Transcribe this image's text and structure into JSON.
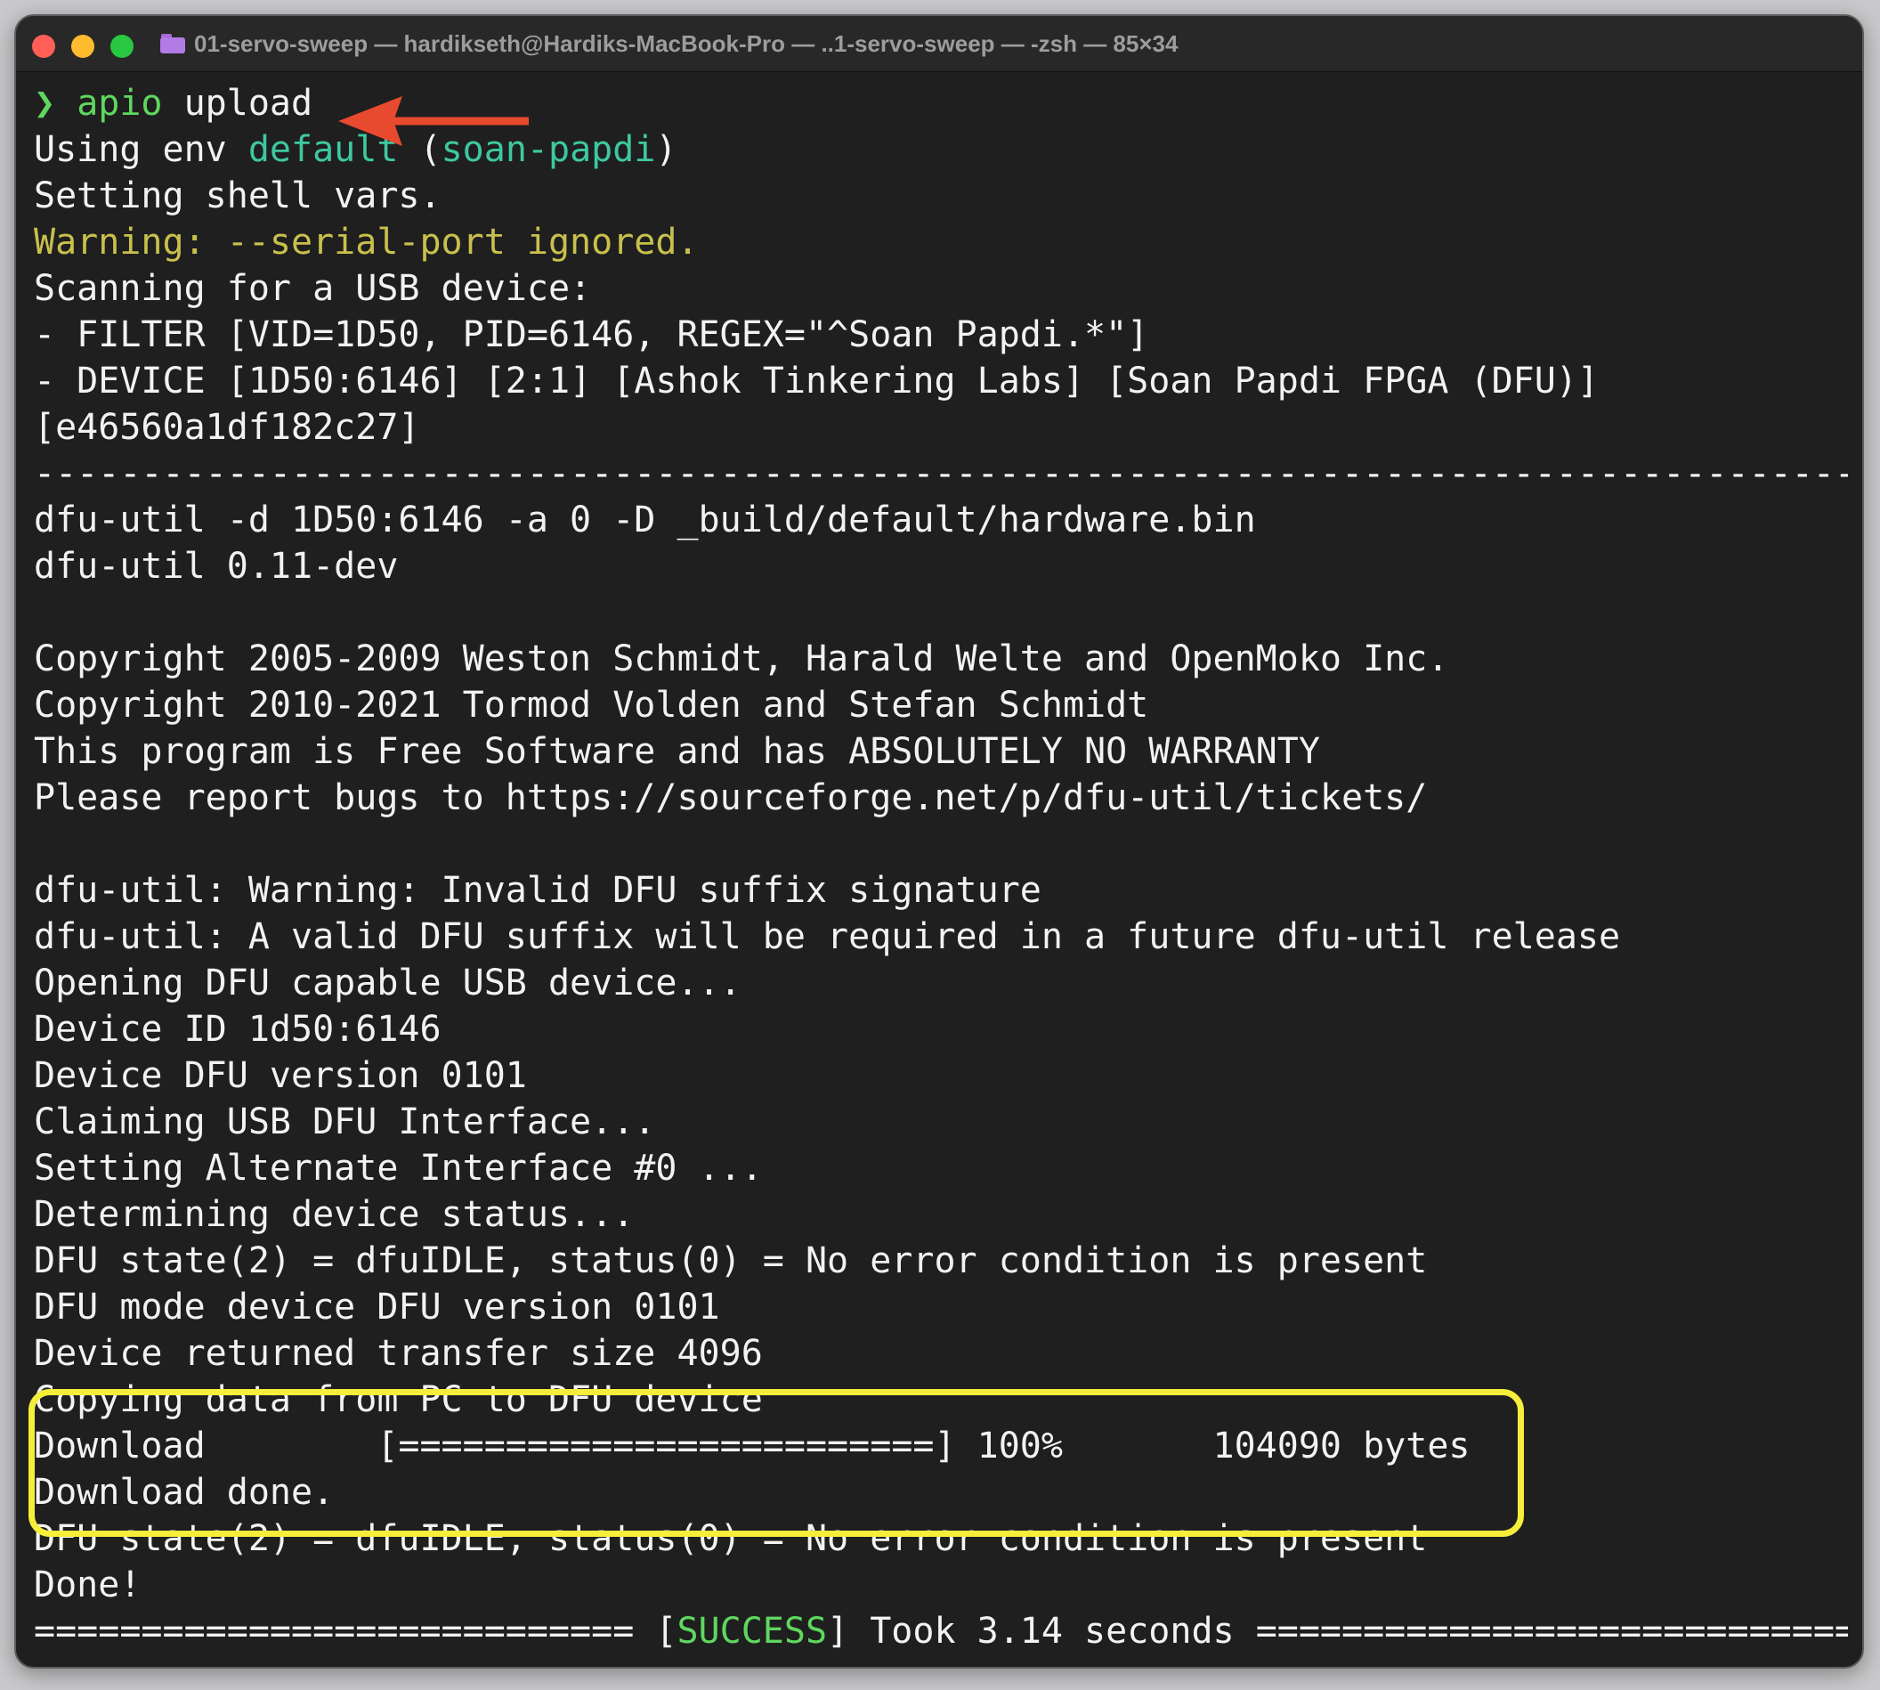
{
  "window": {
    "title": "01-servo-sweep — hardikseth@Hardiks-MacBook-Pro — ..1-servo-sweep — -zsh — 85×34"
  },
  "terminal": {
    "prompt_symbol": "❯",
    "command_name": "apio",
    "command_arg": " upload",
    "env_prefix": "Using env ",
    "env_name": "default",
    "env_open": " (",
    "env_board": "soan-papdi",
    "env_close": ")",
    "shell_vars": "Setting shell vars.",
    "warning": "Warning: --serial-port ignored.",
    "scanning": "Scanning for a USB device:",
    "filter": "- FILTER [VID=1D50, PID=6146, REGEX=\"^Soan Papdi.*\"]",
    "device": "- DEVICE [1D50:6146] [2:1] [Ashok Tinkering Labs] [Soan Papdi FPGA (DFU)]",
    "device_serial": "[e46560a1df182c27]",
    "separator": "-------------------------------------------------------------------------------------",
    "dfu_cmd": "dfu-util -d 1D50:6146 -a 0 -D _build/default/hardware.bin",
    "dfu_version": "dfu-util 0.11-dev",
    "blank": "",
    "copyright1": "Copyright 2005-2009 Weston Schmidt, Harald Welte and OpenMoko Inc.",
    "copyright2": "Copyright 2010-2021 Tormod Volden and Stefan Schmidt",
    "warranty": "This program is Free Software and has ABSOLUTELY NO WARRANTY",
    "bugs": "Please report bugs to https://sourceforge.net/p/dfu-util/tickets/",
    "suffix_warning": "dfu-util: Warning: Invalid DFU suffix signature",
    "suffix_required": "dfu-util: A valid DFU suffix will be required in a future dfu-util release",
    "opening": "Opening DFU capable USB device...",
    "device_id": "Device ID 1d50:6146",
    "device_dfu_version": "Device DFU version 0101",
    "claiming": "Claiming USB DFU Interface...",
    "alternate": "Setting Alternate Interface #0 ...",
    "determining": "Determining device status...",
    "state1": "DFU state(2) = dfuIDLE, status(0) = No error condition is present",
    "mode_version": "DFU mode device DFU version 0101",
    "transfer_size": "Device returned transfer size 4096",
    "copying": "Copying data from PC to DFU device",
    "download_progress": "Download        [=========================] 100%       104090 bytes",
    "download_done": "Download done.",
    "state2": "DFU state(2) = dfuIDLE, status(0) = No error condition is present",
    "done": "Done!",
    "summary_left": "============================ [",
    "summary_status": "SUCCESS",
    "summary_right": "] Took 3.14 seconds ============================"
  },
  "download": {
    "percent": 100,
    "bytes": 104090
  },
  "colors": {
    "prompt": "#5fd75f",
    "env_highlight": "#3ec8a0",
    "warning": "#c8c04c",
    "success": "#5fd75f",
    "annotation_arrow": "#e84a2f",
    "annotation_box": "#f5ee3a"
  }
}
